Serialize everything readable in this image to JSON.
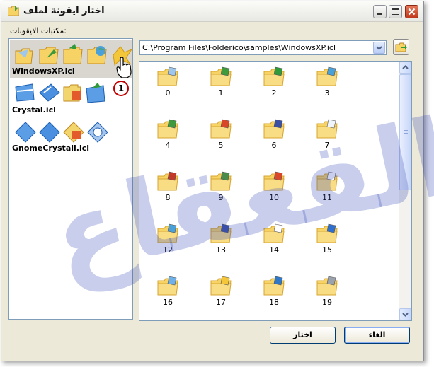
{
  "window": {
    "title": "اختار ايقونة لملف",
    "icon": "folder-icon"
  },
  "library": {
    "label": "مكتبات الايقونات:",
    "items": [
      {
        "name": "WindowsXP.icl",
        "selected": true
      },
      {
        "name": "Crystal.icl",
        "selected": false
      },
      {
        "name": "GnomeCrystall.icl",
        "selected": false
      }
    ]
  },
  "path": {
    "value": "C:\\Program Files\\Folderico\\samples\\WindowsXP.icl"
  },
  "icons": {
    "items": [
      {
        "label": "0",
        "icon": "shortcut-folder-icon"
      },
      {
        "label": "1",
        "icon": "check-folder-icon"
      },
      {
        "label": "2",
        "icon": "arrow-folder-icon"
      },
      {
        "label": "3",
        "icon": "globe-folder-icon"
      },
      {
        "label": "4",
        "icon": "download-folder-icon"
      },
      {
        "label": "5",
        "icon": "red-folder-icon"
      },
      {
        "label": "6",
        "icon": "music-folder-icon"
      },
      {
        "label": "7",
        "icon": "picture-folder-icon"
      },
      {
        "label": "8",
        "icon": "tick-folder-icon"
      },
      {
        "label": "9",
        "icon": "recycle-folder-icon"
      },
      {
        "label": "10",
        "icon": "media-folder-icon"
      },
      {
        "label": "11",
        "icon": "documents-folder-icon"
      },
      {
        "label": "12",
        "icon": "photo-folder-icon"
      },
      {
        "label": "13",
        "icon": "image-folder-icon"
      },
      {
        "label": "14",
        "icon": "file-folder-icon"
      },
      {
        "label": "15",
        "icon": "help-folder-icon"
      },
      {
        "label": "16",
        "icon": "star-folder-icon"
      },
      {
        "label": "17",
        "icon": "open-folder-icon"
      },
      {
        "label": "18",
        "icon": "internet-folder-icon"
      },
      {
        "label": "19",
        "icon": "printer-folder-icon"
      }
    ]
  },
  "buttons": {
    "cancel": "الغاء",
    "ok": "اختار"
  },
  "annotation": {
    "badge": "1"
  },
  "watermark": {
    "text": "القعقاع"
  },
  "colors": {
    "folder": "#f7d366",
    "folder_dark": "#d6a530",
    "accent": "#316ac5",
    "watermark": "#3a4fb8"
  }
}
